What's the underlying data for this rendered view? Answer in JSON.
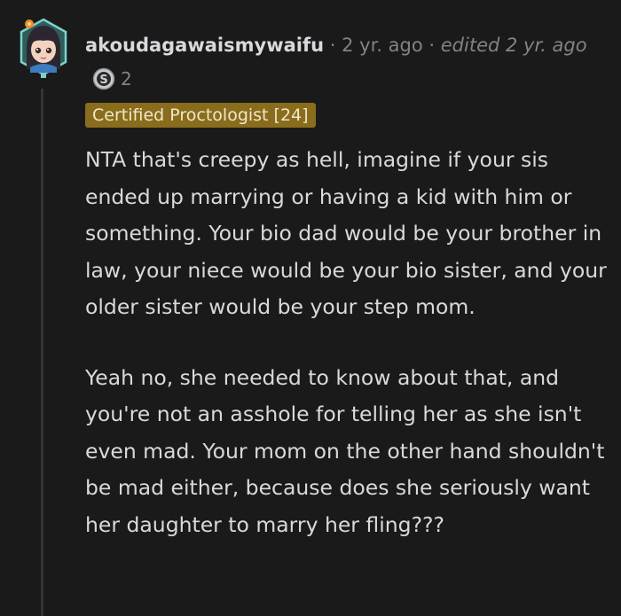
{
  "comment": {
    "username": "akoudagawaismywaifu",
    "separator": "·",
    "time_ago": "2 yr. ago",
    "edited": "edited 2 yr. ago",
    "award_count": "2",
    "flair": "Certified Proctologist [24]",
    "paragraphs": [
      "NTA that's creepy as hell, imagine if your sis ended up marrying or having a kid with him or something. Your bio dad would be your brother in law, your niece would be your bio sister, and your older sister would be your step mom.",
      "Yeah no, she needed to know about that, and you're not an asshole for telling her as she isn't even mad. Your mom on the other hand shouldn't be mad either, because does she seriously want her daughter to marry her fling???"
    ]
  },
  "icons": {
    "avatar": "avatar-icon",
    "award": "silver-award-icon"
  },
  "colors": {
    "background": "#1a1a1b",
    "text": "#d7dadc",
    "meta": "#818384",
    "flair_bg": "#8a6d1c",
    "thread_line": "#343536"
  }
}
